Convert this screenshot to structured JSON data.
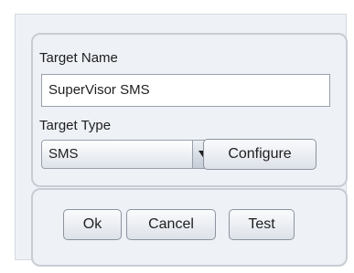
{
  "target_name": {
    "label": "Target Name",
    "value": "SuperVisor SMS"
  },
  "target_type": {
    "label": "Target Type",
    "selected": "SMS",
    "arrow_icon": "triangle-down-icon"
  },
  "buttons": {
    "configure": "Configure",
    "ok": "Ok",
    "cancel": "Cancel",
    "test": "Test"
  }
}
